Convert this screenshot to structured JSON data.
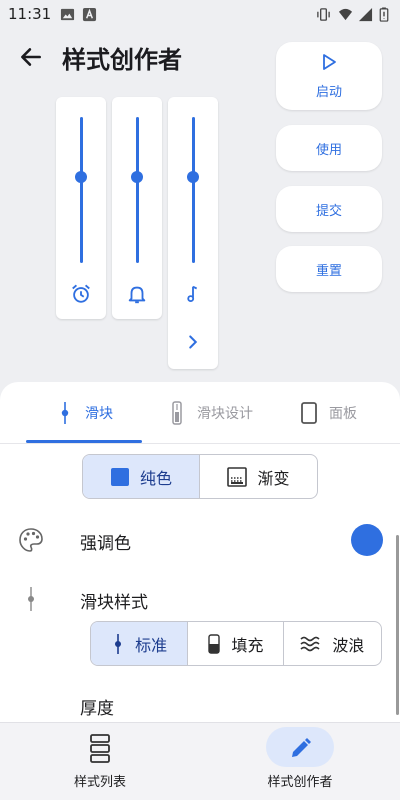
{
  "status_bar": {
    "time": "11:31"
  },
  "header": {
    "title": "样式创作者"
  },
  "actions": {
    "start_label": "启动",
    "use_label": "使用",
    "submit_label": "提交",
    "reset_label": "重置"
  },
  "tabs": [
    {
      "label": "滑块",
      "selected": true
    },
    {
      "label": "滑块设计",
      "selected": false
    },
    {
      "label": "面板",
      "selected": false
    }
  ],
  "color_mode": {
    "options": [
      {
        "label": "纯色",
        "selected": true
      },
      {
        "label": "渐变",
        "selected": false
      }
    ]
  },
  "accent": {
    "label": "强调色",
    "color": "#2f6fe0"
  },
  "slider_style": {
    "label": "滑块样式",
    "options": [
      {
        "label": "标准",
        "selected": true
      },
      {
        "label": "填充",
        "selected": false
      },
      {
        "label": "波浪",
        "selected": false
      }
    ]
  },
  "thickness": {
    "label": "厚度"
  },
  "bottom_nav": {
    "items": [
      {
        "label": "样式列表",
        "selected": false
      },
      {
        "label": "样式创作者",
        "selected": true
      }
    ]
  },
  "colors": {
    "accent": "#2f6fe0",
    "selected_bg": "#dde7fb",
    "background": "#eeeff2"
  }
}
